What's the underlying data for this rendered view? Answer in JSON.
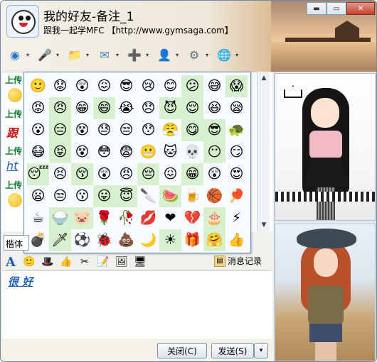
{
  "window": {
    "title": "我的好友-备注_1",
    "subtitle": "跟我一起学MFC 【http://www.gymsaga.com】",
    "buttons": [
      "▬",
      "▭",
      "✕"
    ]
  },
  "toolbar": {
    "items": [
      {
        "name": "video-call",
        "icon": "webcam-icon",
        "glyph": "◉",
        "color": "#2a79c9"
      },
      {
        "name": "voice-call",
        "icon": "microphone-icon",
        "glyph": "🎤",
        "color": "#3a6ea5"
      },
      {
        "name": "send-file",
        "icon": "folder-icon",
        "glyph": "📁",
        "color": "#3a86c9"
      },
      {
        "name": "send-mail",
        "icon": "mail-icon",
        "glyph": "✉",
        "color": "#4e7fb5"
      },
      {
        "name": "create-group",
        "icon": "add-contact-icon",
        "glyph": "➕",
        "color": "#2c9a3a"
      },
      {
        "name": "contact-info",
        "icon": "user-card-icon",
        "glyph": "👤",
        "color": "#3b5f8a"
      },
      {
        "name": "apps",
        "icon": "apps-icon",
        "glyph": "⚙",
        "color": "#5a6f86"
      },
      {
        "name": "browser",
        "icon": "globe-icon",
        "glyph": "🌐",
        "color": "#2a79c9"
      }
    ]
  },
  "history": {
    "labels": [
      "上传",
      "上传",
      "上传",
      "上传"
    ],
    "red_text": "跟",
    "blue_text": "ht"
  },
  "emoji_panel": {
    "rows": [
      [
        "🙂",
        "😟",
        "😲",
        "😖",
        "😎",
        "😢",
        "😊",
        "😕",
        "😅",
        "😱"
      ],
      [
        "😡",
        "😠",
        "😁",
        "😄",
        "😭",
        "😞",
        "😈",
        "😌",
        "😆",
        "😪"
      ],
      [
        "😮",
        "😑",
        "😵",
        "😓",
        "😒",
        "😯",
        "😤",
        "😋",
        "😎",
        "🐢"
      ],
      [
        "😷",
        "😝",
        "😵",
        "😳",
        "😨",
        "😬",
        "🐱",
        "💀",
        "😶",
        "😏"
      ],
      [
        "😴",
        "😣",
        "😚",
        "😲",
        "😠",
        "😔",
        "😖",
        "😁",
        "😲",
        "😍"
      ],
      [
        "😦",
        "😒",
        "😗",
        "😛",
        "😇",
        "🔪",
        "🍉",
        "🍺",
        "🏀",
        "🏓"
      ],
      [
        "☕",
        "🍚",
        "🐷",
        "🌹",
        "🥀",
        "💋",
        "❤",
        "💔",
        "🎂",
        "⚡"
      ],
      [
        "💣",
        "🗡",
        "⚽",
        "🐞",
        "💩",
        "🌙",
        "☀",
        "🎁",
        "🤗",
        "👍"
      ]
    ],
    "highlighted": [
      [
        0,
        7
      ],
      [
        0,
        9
      ],
      [
        1,
        1
      ],
      [
        1,
        3
      ],
      [
        1,
        6
      ],
      [
        1,
        7
      ],
      [
        2,
        1
      ],
      [
        2,
        7
      ],
      [
        2,
        8
      ],
      [
        3,
        1
      ],
      [
        3,
        8
      ],
      [
        4,
        0
      ],
      [
        4,
        2
      ],
      [
        4,
        5
      ],
      [
        4,
        7
      ],
      [
        5,
        3
      ],
      [
        5,
        4
      ],
      [
        5,
        6
      ],
      [
        6,
        1
      ],
      [
        6,
        2
      ],
      [
        6,
        8
      ],
      [
        7,
        1
      ],
      [
        7,
        6
      ],
      [
        7,
        8
      ]
    ]
  },
  "input": {
    "font_name": "楷体",
    "history_label": "消息记录",
    "typed_text": "很 好",
    "format_icons": [
      "font-icon",
      "emoji-icon",
      "wizard-hat-icon",
      "thumb-icon",
      "screenshot-icon",
      "note-icon",
      "image-icon",
      "screen-icon"
    ]
  },
  "buttons": {
    "close": "关闭(C)",
    "send": "发送(S)",
    "send_dropdown": "▾"
  },
  "scrollbar": {
    "up": "▲",
    "down": "▼"
  }
}
